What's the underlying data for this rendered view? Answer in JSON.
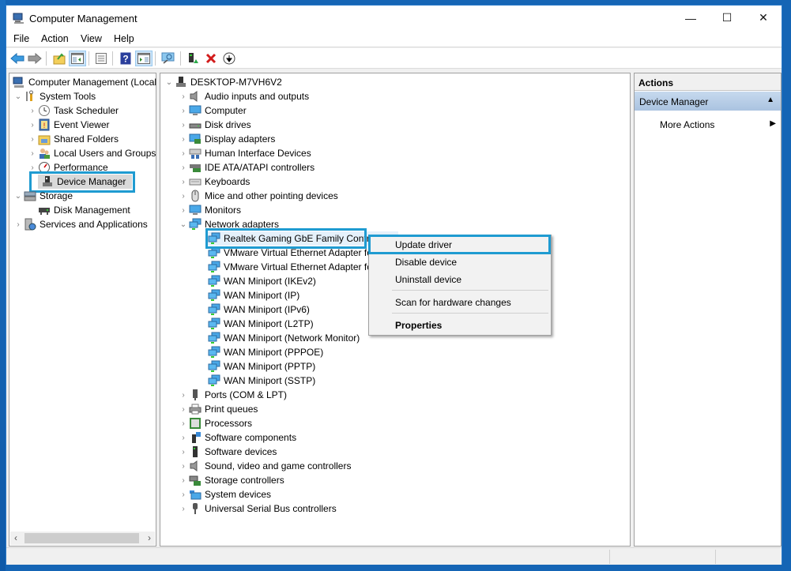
{
  "window": {
    "title": "Computer Management",
    "controls": {
      "minimize": "—",
      "maximize": "☐",
      "close": "✕"
    }
  },
  "menubar": [
    "File",
    "Action",
    "View",
    "Help"
  ],
  "toolbar": [
    {
      "icon": "back-arrow-icon"
    },
    {
      "icon": "forward-arrow-icon"
    },
    {
      "icon": "up-folder-icon"
    },
    {
      "icon": "show-hide-console-tree-icon",
      "pressed": true
    },
    {
      "icon": "properties-icon"
    },
    {
      "icon": "help-icon"
    },
    {
      "icon": "show-hide-action-pane-icon",
      "pressed": true
    },
    {
      "icon": "scan-hardware-icon"
    },
    {
      "icon": "update-driver-icon"
    },
    {
      "icon": "uninstall-icon"
    },
    {
      "icon": "download-icon"
    }
  ],
  "left_tree": [
    {
      "label": "Computer Management (Local",
      "icon": "computer-management-icon",
      "level": 0,
      "chevron": ""
    },
    {
      "label": "System Tools",
      "icon": "system-tools-icon",
      "level": 1,
      "chevron": "expanded"
    },
    {
      "label": "Task Scheduler",
      "icon": "task-scheduler-icon",
      "level": 2,
      "chevron": "collapsed"
    },
    {
      "label": "Event Viewer",
      "icon": "event-viewer-icon",
      "level": 2,
      "chevron": "collapsed"
    },
    {
      "label": "Shared Folders",
      "icon": "shared-folders-icon",
      "level": 2,
      "chevron": "collapsed"
    },
    {
      "label": "Local Users and Groups",
      "icon": "local-users-icon",
      "level": 2,
      "chevron": "collapsed"
    },
    {
      "label": "Performance",
      "icon": "performance-icon",
      "level": 2,
      "chevron": "collapsed"
    },
    {
      "label": "Device Manager",
      "icon": "device-manager-icon",
      "level": 2,
      "chevron": "",
      "selected": true
    },
    {
      "label": "Storage",
      "icon": "storage-icon",
      "level": 1,
      "chevron": "expanded"
    },
    {
      "label": "Disk Management",
      "icon": "disk-management-icon",
      "level": 2,
      "chevron": ""
    },
    {
      "label": "Services and Applications",
      "icon": "services-icon",
      "level": 1,
      "chevron": "collapsed"
    }
  ],
  "device_tree": {
    "root": "DESKTOP-M7VH6V2",
    "categories": [
      {
        "label": "Audio inputs and outputs",
        "icon": "speaker-icon"
      },
      {
        "label": "Computer",
        "icon": "monitor-icon"
      },
      {
        "label": "Disk drives",
        "icon": "disk-drive-icon"
      },
      {
        "label": "Display adapters",
        "icon": "display-adapter-icon"
      },
      {
        "label": "Human Interface Devices",
        "icon": "hid-icon"
      },
      {
        "label": "IDE ATA/ATAPI controllers",
        "icon": "ide-controller-icon"
      },
      {
        "label": "Keyboards",
        "icon": "keyboard-icon"
      },
      {
        "label": "Mice and other pointing devices",
        "icon": "mouse-icon"
      },
      {
        "label": "Monitors",
        "icon": "monitor-icon"
      },
      {
        "label": "Network adapters",
        "icon": "network-adapter-icon",
        "expanded": true,
        "children": [
          "Realtek Gaming GbE Family Contro",
          "VMware Virtual Ethernet Adapter fo",
          "VMware Virtual Ethernet Adapter fo",
          "WAN Miniport (IKEv2)",
          "WAN Miniport (IP)",
          "WAN Miniport (IPv6)",
          "WAN Miniport (L2TP)",
          "WAN Miniport (Network Monitor)",
          "WAN Miniport (PPPOE)",
          "WAN Miniport (PPTP)",
          "WAN Miniport (SSTP)"
        ]
      },
      {
        "label": "Ports (COM & LPT)",
        "icon": "port-icon"
      },
      {
        "label": "Print queues",
        "icon": "printer-icon"
      },
      {
        "label": "Processors",
        "icon": "processor-icon"
      },
      {
        "label": "Software components",
        "icon": "software-component-icon"
      },
      {
        "label": "Software devices",
        "icon": "software-device-icon"
      },
      {
        "label": "Sound, video and game controllers",
        "icon": "speaker-icon"
      },
      {
        "label": "Storage controllers",
        "icon": "storage-controller-icon"
      },
      {
        "label": "System devices",
        "icon": "system-devices-icon"
      },
      {
        "label": "Universal Serial Bus controllers",
        "icon": "usb-icon"
      }
    ]
  },
  "context_menu": {
    "items": [
      "Update driver",
      "Disable device",
      "Uninstall device",
      "Scan for hardware changes",
      "Properties"
    ],
    "highlighted": "Update driver"
  },
  "actions_pane": {
    "header": "Actions",
    "section": "Device Manager",
    "more_actions": "More Actions"
  },
  "colors": {
    "highlight_border": "#1f9bd1",
    "desktop": "#1565b5",
    "actions_section": "#b8cfe8"
  }
}
